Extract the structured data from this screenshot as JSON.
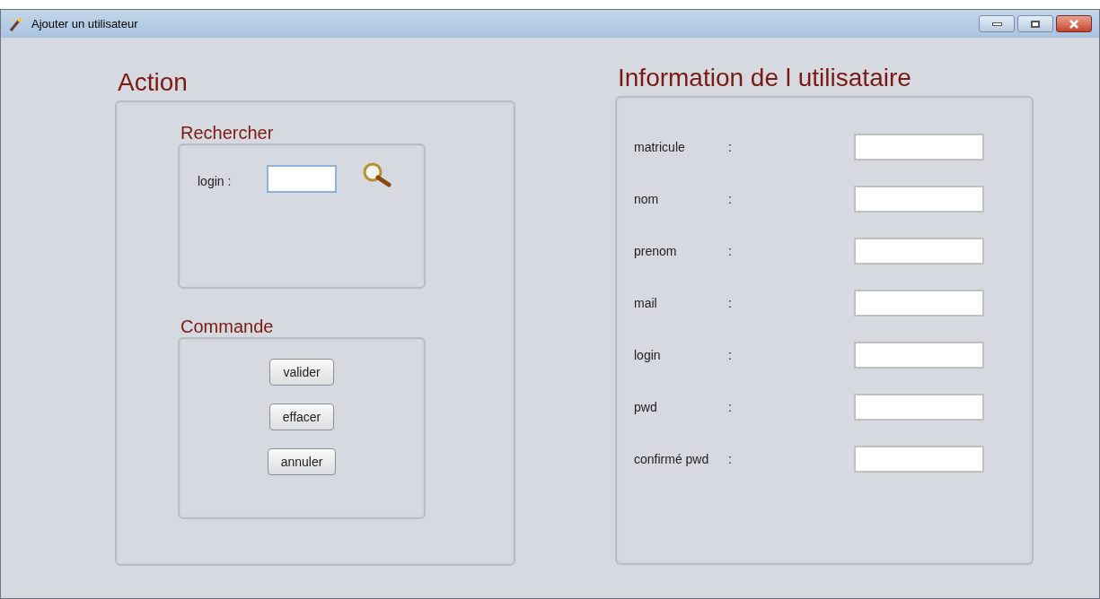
{
  "window": {
    "title": "Ajouter un utilisateur"
  },
  "action": {
    "title": "Action",
    "search": {
      "title": "Rechercher",
      "label": "login :"
    },
    "commands": {
      "title": "Commande",
      "buttons": [
        "valider",
        "effacer",
        "annuler"
      ]
    }
  },
  "user_info": {
    "title": "Information de l utilisataire",
    "fields": [
      {
        "label": "matricule",
        "colon": ":"
      },
      {
        "label": "nom",
        "colon": ":"
      },
      {
        "label": "prenom",
        "colon": ":"
      },
      {
        "label": "mail",
        "colon": ":"
      },
      {
        "label": "login",
        "colon": ":"
      },
      {
        "label": "pwd",
        "colon": ":"
      },
      {
        "label": "confirmé pwd",
        "colon": ":"
      }
    ]
  }
}
